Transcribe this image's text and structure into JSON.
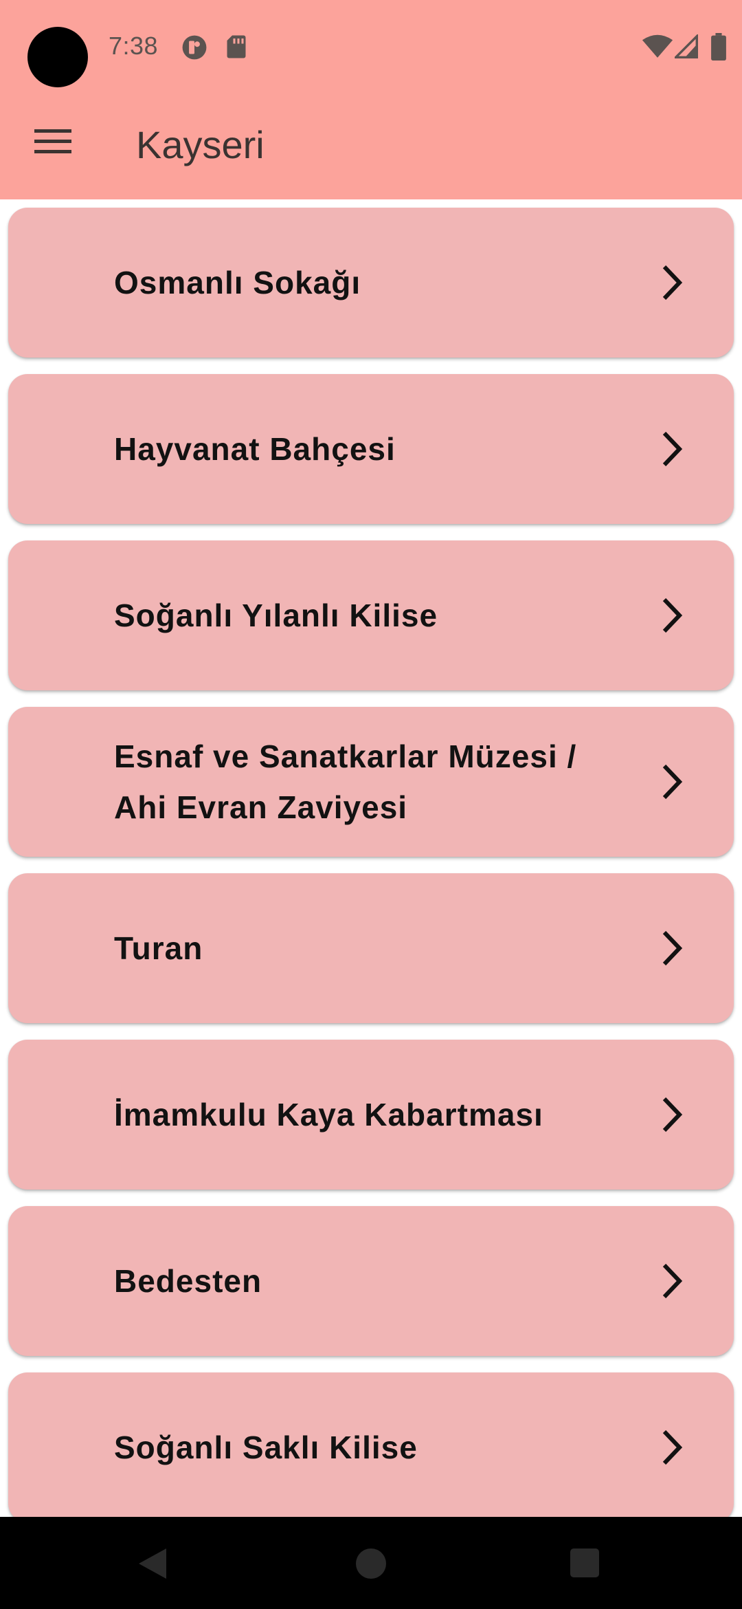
{
  "status_bar": {
    "time": "7:38",
    "icons": [
      "camera-cutout",
      "circle-badge-icon",
      "sd-card-icon",
      "wifi-icon",
      "signal-icon",
      "battery-icon"
    ]
  },
  "app_bar": {
    "menu_icon": "hamburger-menu-icon",
    "title": "Kayseri",
    "background": "#FCA39B"
  },
  "list": {
    "card_color": "#F1B5B5",
    "item_icon": "chevron-right-icon",
    "items": [
      {
        "label": "Osmanlı Sokağı"
      },
      {
        "label": "Hayvanat Bahçesi"
      },
      {
        "label": "Soğanlı Yılanlı Kilise"
      },
      {
        "label": "Esnaf ve Sanatkarlar Müzesi / Ahi Evran Zaviyesi"
      },
      {
        "label": "Turan"
      },
      {
        "label": "İmamkulu Kaya Kabartması"
      },
      {
        "label": "Bedesten"
      },
      {
        "label": "Soğanlı Saklı Kilise"
      }
    ]
  },
  "nav_bar": {
    "icons": [
      "back-icon",
      "home-icon",
      "recent-apps-icon"
    ]
  }
}
